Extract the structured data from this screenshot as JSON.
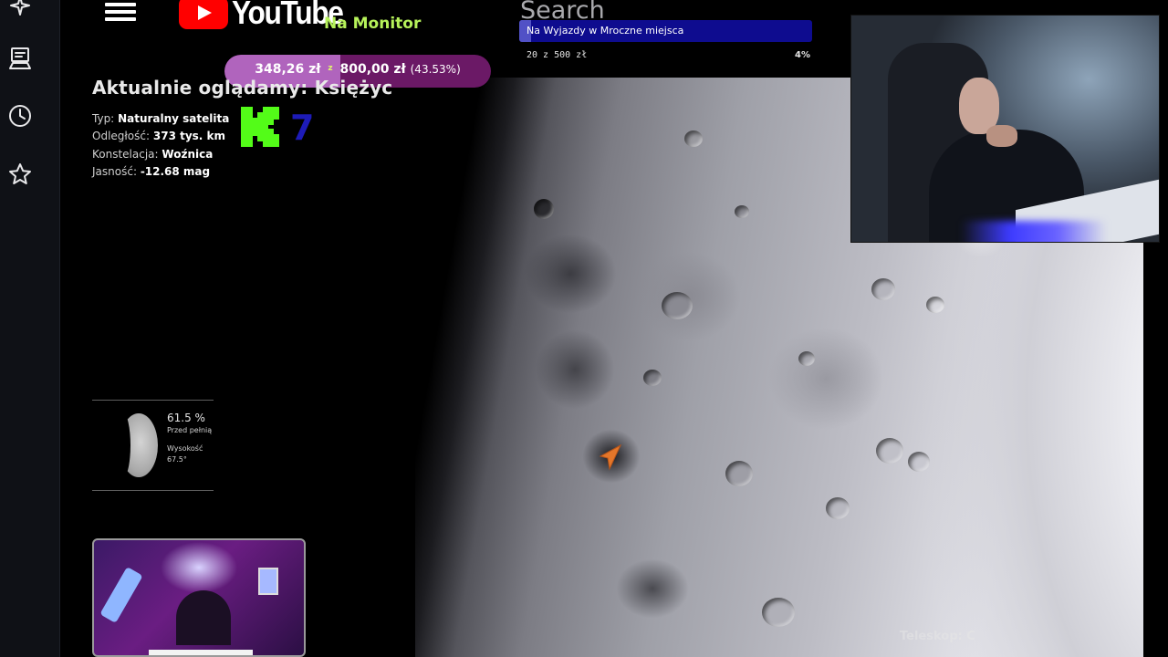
{
  "header": {
    "brand": "YouTube",
    "channel_subtitle": "Na Monitor",
    "search_placeholder": "Search"
  },
  "donation": {
    "raised": "348,26 zł",
    "separator": "z",
    "goal": "800,00 zł",
    "percent_label": "(43.53%)",
    "progress_percent": 43.53
  },
  "trip_goal": {
    "label": "Na Wyjazdy w Mroczne miejsca",
    "count": "20 z 500 zł",
    "percent_label": "4%",
    "progress_percent": 4
  },
  "object": {
    "title": "Aktualnie oglądamy: Księżyc",
    "rows": [
      {
        "key": "Typ:",
        "value": "Naturalny satelita"
      },
      {
        "key": "Odległość:",
        "value": "373 tys. km"
      },
      {
        "key": "Konstelacja:",
        "value": "Woźnica"
      },
      {
        "key": "Jasność:",
        "value": "-12.68 mag"
      }
    ],
    "kick_count": "7"
  },
  "moon_phase": {
    "illumination": "61.5 %",
    "phase_label": "Przed pełnią",
    "altitude_label": "Wysokość",
    "altitude_value": "67.5°"
  },
  "feed": {
    "watermark": "Teleskop: C"
  },
  "colors": {
    "donation_bg": "#6b1966",
    "donation_fill": "#b064bd",
    "goal_bg": "#0e0c8f",
    "kick_green": "#53fc18",
    "brand_red": "#ff0000",
    "subtitle_green": "#b6f25a"
  },
  "icons": [
    "sparkle-icon",
    "monitor-icon",
    "clock-icon",
    "star-icon",
    "menu-icon",
    "youtube-play-icon",
    "kick-logo-icon",
    "cursor-arrow-icon"
  ]
}
